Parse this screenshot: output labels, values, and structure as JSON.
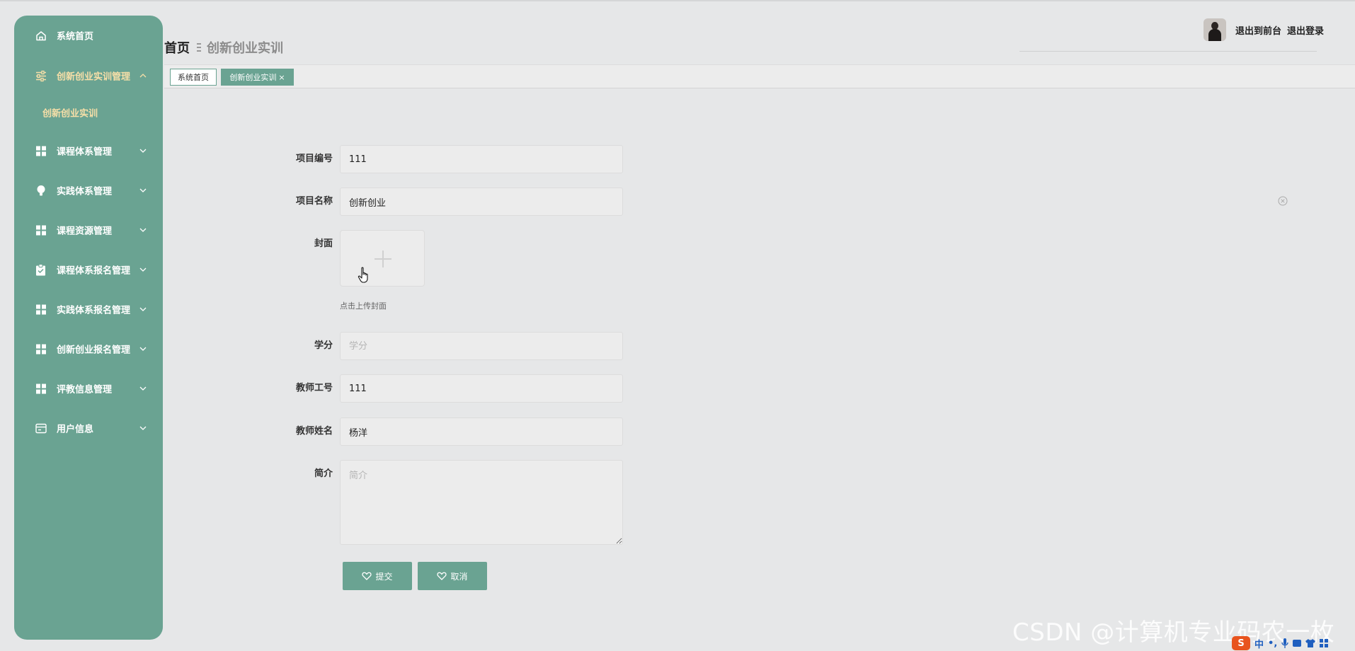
{
  "sidebar": {
    "items": [
      {
        "label": "系统首页",
        "icon": "home-icon",
        "has_arrow": false
      },
      {
        "label": "创新创业实训管理",
        "icon": "sliders-icon",
        "has_arrow": true,
        "expanded": true
      },
      {
        "label": "课程体系管理",
        "icon": "grid-icon",
        "has_arrow": true
      },
      {
        "label": "实践体系管理",
        "icon": "bulb-icon",
        "has_arrow": true
      },
      {
        "label": "课程资源管理",
        "icon": "grid-icon",
        "has_arrow": true
      },
      {
        "label": "课程体系报名管理",
        "icon": "clipboard-icon",
        "has_arrow": true
      },
      {
        "label": "实践体系报名管理",
        "icon": "grid-icon",
        "has_arrow": true
      },
      {
        "label": "创新创业报名管理",
        "icon": "grid-icon",
        "has_arrow": true
      },
      {
        "label": "评教信息管理",
        "icon": "grid-icon",
        "has_arrow": true
      },
      {
        "label": "用户信息",
        "icon": "card-icon",
        "has_arrow": true
      }
    ],
    "submenu": {
      "label": "创新创业实训"
    }
  },
  "header": {
    "breadcrumb_home": "首页",
    "breadcrumb_current": "创新创业实训",
    "links": {
      "frontend": "退出到前台",
      "logout": "退出登录"
    }
  },
  "tabs": {
    "home": "系统首页",
    "active": "创新创业实训",
    "close_glyph": "×"
  },
  "form": {
    "project_no": {
      "label": "项目编号",
      "value": "111",
      "placeholder": "项目编号"
    },
    "project_name": {
      "label": "项目名称",
      "value": "创新创业",
      "placeholder": "项目名称"
    },
    "cover": {
      "label": "封面",
      "hint": "点击上传封面"
    },
    "credits": {
      "label": "学分",
      "value": "",
      "placeholder": "学分"
    },
    "teacher_no": {
      "label": "教师工号",
      "value": "111",
      "placeholder": "教师工号"
    },
    "teacher_name": {
      "label": "教师姓名",
      "value": "杨洋",
      "placeholder": "教师姓名"
    },
    "intro": {
      "label": "简介",
      "value": "",
      "placeholder": "简介"
    },
    "submit_label": "提交",
    "cancel_label": "取消"
  },
  "watermark": "CSDN @计算机专业码农一枚",
  "ime": {
    "logo": "S",
    "lang": "中"
  },
  "colors": {
    "accent": "#6aa392",
    "active_menu_text": "#f7dfa8",
    "background": "#e6e7e8"
  }
}
